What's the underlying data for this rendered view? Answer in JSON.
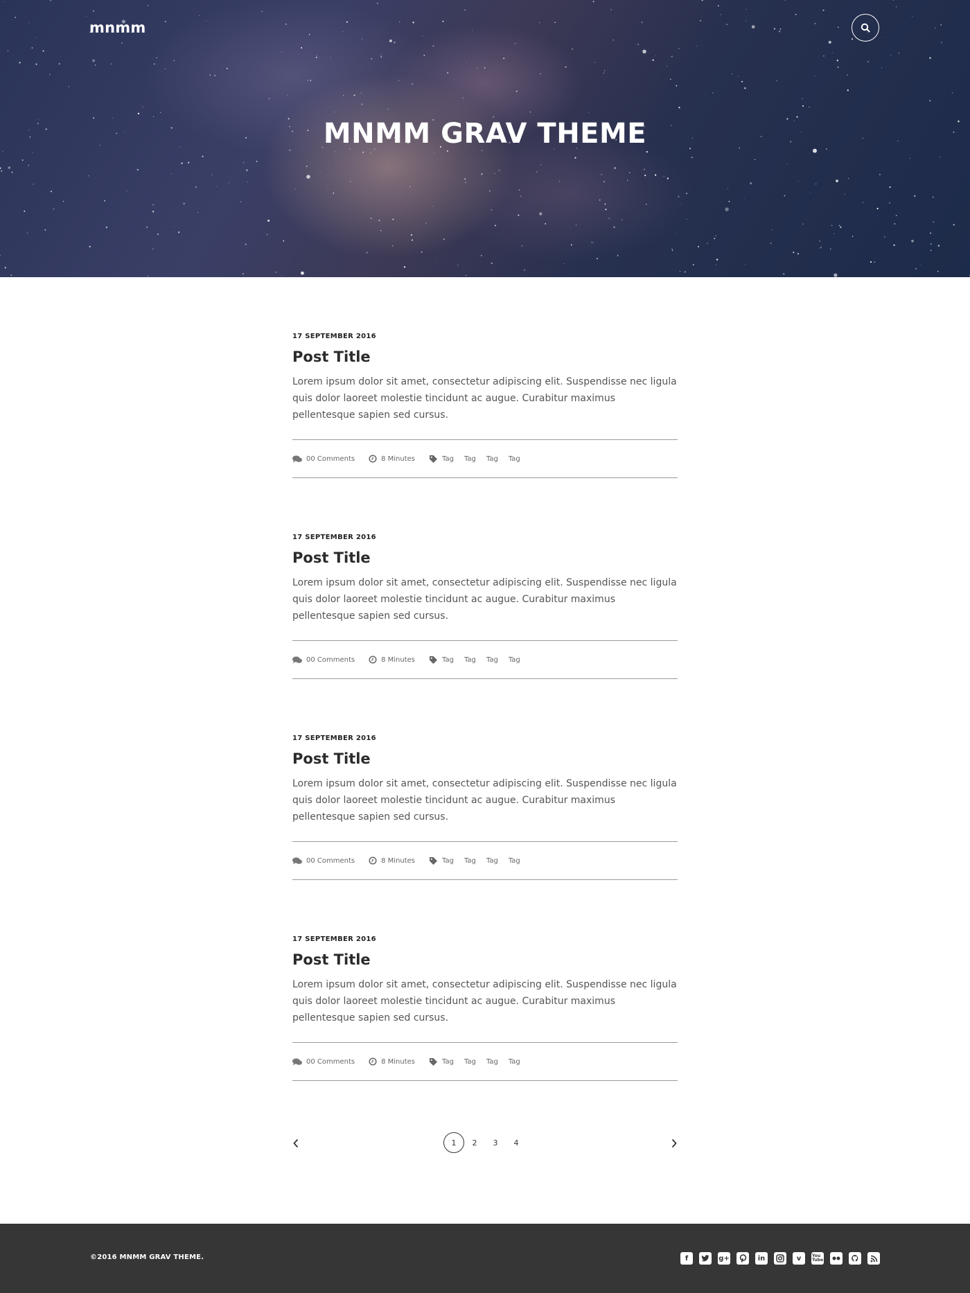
{
  "header": {
    "brand": "mnmm",
    "hero_title": "MNMM GRAV THEME",
    "search_icon": "search-icon"
  },
  "posts": [
    {
      "date": "17 SEPTEMBER 2016",
      "title": "Post Title",
      "excerpt": "Lorem ipsum dolor sit amet, consectetur adipiscing elit. Suspendisse nec ligula quis dolor laoreet molestie tincidunt ac augue. Curabitur maximus pellentesque sapien sed cursus.",
      "comments": "00 Comments",
      "read_time": "8 Minutes",
      "tags": [
        "Tag",
        "Tag",
        "Tag",
        "Tag"
      ]
    },
    {
      "date": "17 SEPTEMBER 2016",
      "title": "Post Title",
      "excerpt": "Lorem ipsum dolor sit amet, consectetur adipiscing elit. Suspendisse nec ligula quis dolor laoreet molestie tincidunt ac augue. Curabitur maximus pellentesque sapien sed cursus.",
      "comments": "00 Comments",
      "read_time": "8 Minutes",
      "tags": [
        "Tag",
        "Tag",
        "Tag",
        "Tag"
      ]
    },
    {
      "date": "17 SEPTEMBER 2016",
      "title": "Post Title",
      "excerpt": "Lorem ipsum dolor sit amet, consectetur adipiscing elit. Suspendisse nec ligula quis dolor laoreet molestie tincidunt ac augue. Curabitur maximus pellentesque sapien sed cursus.",
      "comments": "00 Comments",
      "read_time": "8 Minutes",
      "tags": [
        "Tag",
        "Tag",
        "Tag",
        "Tag"
      ]
    },
    {
      "date": "17 SEPTEMBER 2016",
      "title": "Post Title",
      "excerpt": "Lorem ipsum dolor sit amet, consectetur adipiscing elit. Suspendisse nec ligula quis dolor laoreet molestie tincidunt ac augue. Curabitur maximus pellentesque sapien sed cursus.",
      "comments": "00 Comments",
      "read_time": "8 Minutes",
      "tags": [
        "Tag",
        "Tag",
        "Tag",
        "Tag"
      ]
    }
  ],
  "pagination": {
    "pages": [
      "1",
      "2",
      "3",
      "4"
    ],
    "current": "1",
    "prev_icon": "chevron-left-icon",
    "next_icon": "chevron-right-icon"
  },
  "footer": {
    "copyright": "©2016 MNMM GRAV THEME.",
    "socials": [
      "facebook-icon",
      "twitter-icon",
      "google-plus-icon",
      "pinterest-icon",
      "linkedin-icon",
      "instagram-icon",
      "vimeo-icon",
      "youtube-icon",
      "flickr-icon",
      "github-icon",
      "rss-icon"
    ]
  },
  "colors": {
    "footer_bg": "#363636",
    "text_dark": "#2b2b2b",
    "text_body": "#555555",
    "divider": "#9a9a9a"
  }
}
